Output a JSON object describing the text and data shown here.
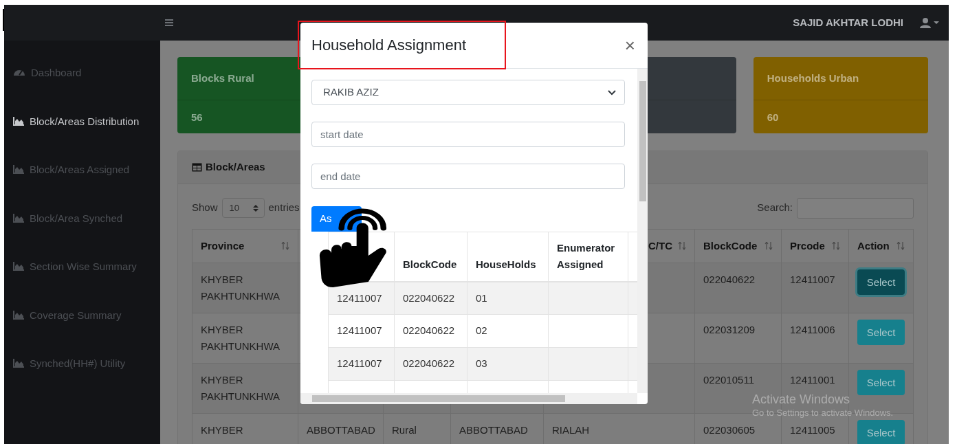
{
  "topbar": {
    "user_name": "SAJID AKHTAR LODHI"
  },
  "sidebar": {
    "items": [
      {
        "label": "Dashboard",
        "kind": "gauge",
        "selected": false
      },
      {
        "label": "Block/Areas Distribution",
        "kind": "chart",
        "selected": true
      },
      {
        "label": "Block/Areas Assigned",
        "kind": "chart",
        "selected": false
      },
      {
        "label": "Block/Area Synched",
        "kind": "chart",
        "selected": false
      },
      {
        "label": "Section Wise Summary",
        "kind": "chart",
        "selected": false
      },
      {
        "label": "Coverage Summary",
        "kind": "chart",
        "selected": false
      },
      {
        "label": "Synched(HH#) Utility",
        "kind": "chart",
        "selected": false
      }
    ]
  },
  "stat_cards": [
    {
      "title": "Blocks Rural",
      "value": "56",
      "color": "#165523"
    },
    {
      "color": "#33383d"
    },
    {
      "title": "Households Urban",
      "value": "60",
      "color": "#806000"
    }
  ],
  "blocks_panel": {
    "title": "Block/Areas",
    "show_label": "Show",
    "page_size": "10",
    "entries_label": "entries",
    "search_label": "Search:",
    "columns": {
      "province": "Province",
      "column_5": "C/TC",
      "block_code": "BlockCode",
      "prcode": "Prcode",
      "action": "Action"
    },
    "rows": [
      {
        "province": "KHYBER PAKHTUNKHWA",
        "block_code": "022040622",
        "prcode": "12411007",
        "action": "Select",
        "focused": true
      },
      {
        "province": "KHYBER PAKHTUNKHWA",
        "block_code": "022031209",
        "prcode": "12411006",
        "action": "Select",
        "focused": false
      },
      {
        "province": "KHYBER PAKHTUNKHWA",
        "block_code": "022010511",
        "prcode": "12411001",
        "action": "Select",
        "focused": false
      },
      {
        "province": "KHYBER",
        "column_2": "ABBOTTABAD",
        "column_3": "Rural",
        "column_4": "ABBOTTABAD",
        "column_5": "RIALAH",
        "block_code": "022030605",
        "prcode": "12411005",
        "action": "Select",
        "focused": false
      }
    ]
  },
  "dialog": {
    "title": "Household Assignment",
    "close": "×",
    "enumerator": "RAKIB AZIZ",
    "start_placeholder": "start date",
    "end_placeholder": "end date",
    "assign": "As",
    "columns": {
      "block_code": "BlockCode",
      "households": "HouseHolds",
      "enumerator": "Enumerator Assigned"
    },
    "rows": [
      {
        "prcode": "12411007",
        "block_code": "022040622",
        "households": "01"
      },
      {
        "prcode": "12411007",
        "block_code": "022040622",
        "households": "02"
      },
      {
        "prcode": "12411007",
        "block_code": "022040622",
        "households": "03"
      }
    ]
  },
  "os_notice": {
    "title": "Activate Windows",
    "subtitle": "Go to Settings to activate Windows."
  }
}
